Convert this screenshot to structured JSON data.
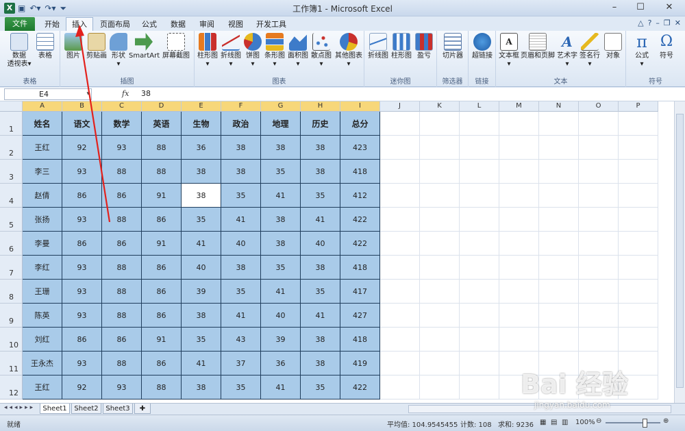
{
  "window": {
    "title": "工作簿1 - Microsoft Excel",
    "app_icon": "X"
  },
  "ribbon": {
    "file_tab": "文件",
    "tabs": [
      "开始",
      "插入",
      "页面布局",
      "公式",
      "数据",
      "审阅",
      "视图",
      "开发工具"
    ],
    "active_tab": "插入",
    "groups": [
      {
        "label": "表格",
        "buttons": [
          "数据\n透视表",
          "表格"
        ]
      },
      {
        "label": "插图",
        "buttons": [
          "图片",
          "剪贴画",
          "形状",
          "SmartArt",
          "屏幕截图"
        ]
      },
      {
        "label": "图表",
        "buttons": [
          "柱形图",
          "折线图",
          "饼图",
          "条形图",
          "面积图",
          "散点图",
          "其他图表"
        ]
      },
      {
        "label": "迷你图",
        "buttons": [
          "折线图",
          "柱形图",
          "盈亏"
        ]
      },
      {
        "label": "筛选器",
        "buttons": [
          "切片器"
        ]
      },
      {
        "label": "链接",
        "buttons": [
          "超链接"
        ]
      },
      {
        "label": "文本",
        "buttons": [
          "文本框",
          "页眉和页脚",
          "艺术字",
          "签名行",
          "对象"
        ]
      },
      {
        "label": "符号",
        "buttons": [
          "公式",
          "符号"
        ]
      }
    ]
  },
  "formula_bar": {
    "name_box": "E4",
    "fx": "fx",
    "value": "38"
  },
  "grid": {
    "columns": [
      "A",
      "B",
      "C",
      "D",
      "E",
      "F",
      "G",
      "H",
      "I",
      "J",
      "K",
      "L",
      "M",
      "N",
      "O",
      "P"
    ],
    "rows": [
      "1",
      "2",
      "3",
      "4",
      "5",
      "6",
      "7",
      "8",
      "9",
      "10",
      "11",
      "12"
    ],
    "header": [
      "姓名",
      "语文",
      "数学",
      "英语",
      "生物",
      "政治",
      "地理",
      "历史",
      "总分"
    ],
    "data": [
      [
        "王红",
        "92",
        "93",
        "88",
        "36",
        "38",
        "38",
        "38",
        "423"
      ],
      [
        "李三",
        "93",
        "88",
        "88",
        "38",
        "38",
        "35",
        "38",
        "418"
      ],
      [
        "赵倩",
        "86",
        "86",
        "91",
        "38",
        "35",
        "41",
        "35",
        "412"
      ],
      [
        "张扬",
        "93",
        "88",
        "86",
        "35",
        "41",
        "38",
        "41",
        "422"
      ],
      [
        "李曼",
        "86",
        "86",
        "91",
        "41",
        "40",
        "38",
        "40",
        "422"
      ],
      [
        "李红",
        "93",
        "88",
        "86",
        "40",
        "38",
        "35",
        "38",
        "418"
      ],
      [
        "王珊",
        "93",
        "88",
        "86",
        "39",
        "35",
        "41",
        "35",
        "417"
      ],
      [
        "陈英",
        "93",
        "88",
        "86",
        "38",
        "41",
        "40",
        "41",
        "427"
      ],
      [
        "刘红",
        "86",
        "86",
        "91",
        "35",
        "43",
        "39",
        "38",
        "418"
      ],
      [
        "王永杰",
        "93",
        "88",
        "86",
        "41",
        "37",
        "36",
        "38",
        "419"
      ],
      [
        "王红",
        "92",
        "93",
        "88",
        "38",
        "35",
        "41",
        "35",
        "422"
      ]
    ],
    "active_cell": "E4",
    "fill_color": "#a9cbe9"
  },
  "sheets": {
    "tabs": [
      "Sheet1",
      "Sheet2",
      "Sheet3"
    ],
    "active": "Sheet1"
  },
  "status": {
    "ready": "就绪",
    "average": "平均值: 104.9545455",
    "count": "计数: 108",
    "sum": "求和: 9236",
    "zoom": "100%"
  },
  "watermark": {
    "logo": "Bai 经验",
    "url": "jingyan.baidu.com"
  }
}
